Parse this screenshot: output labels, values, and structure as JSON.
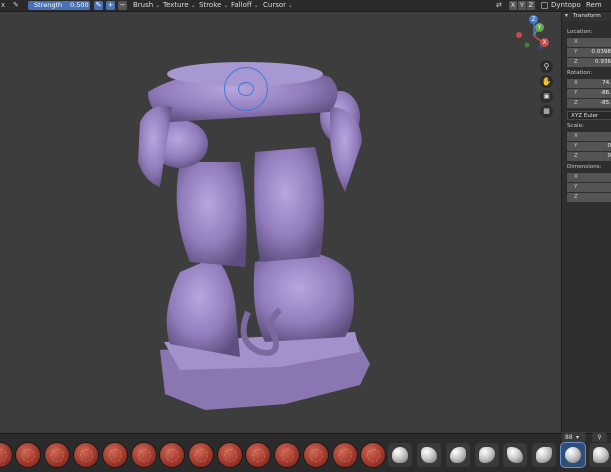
{
  "toolbar": {
    "strength_label": "Strength",
    "strength_value": "0.500",
    "menus": [
      "Brush",
      "Texture",
      "Stroke",
      "Falloff",
      "Cursor"
    ],
    "axes": [
      "X",
      "Y",
      "Z"
    ],
    "dyntopo_label": "Dyntopo",
    "remesh_label": "Rem"
  },
  "npanel": {
    "section_title": "Transform",
    "location": {
      "label": "Location:",
      "x": "",
      "y": "0.0398",
      "z": "0.936"
    },
    "rotation": {
      "label": "Rotation:",
      "x": "74.",
      "y": "-86.",
      "z": "-85.",
      "mode": "XYZ Euler"
    },
    "scale": {
      "label": "Scale:",
      "x": "",
      "y": "0",
      "z": "0"
    },
    "dimensions": {
      "label": "Dimensions:",
      "x": "",
      "y": "",
      "z": ""
    },
    "axis_letters": [
      "X",
      "Y",
      "Z"
    ]
  },
  "gizmo": {
    "x": "X",
    "y": "Y",
    "z": "Z"
  },
  "brushbar": {
    "collection_label": "88"
  },
  "colors": {
    "accent": "#4772b3",
    "viewport_bg": "#3d3d3d",
    "sculpt_mesh": "#9a87c4",
    "brush_red": "#b33c2e"
  }
}
